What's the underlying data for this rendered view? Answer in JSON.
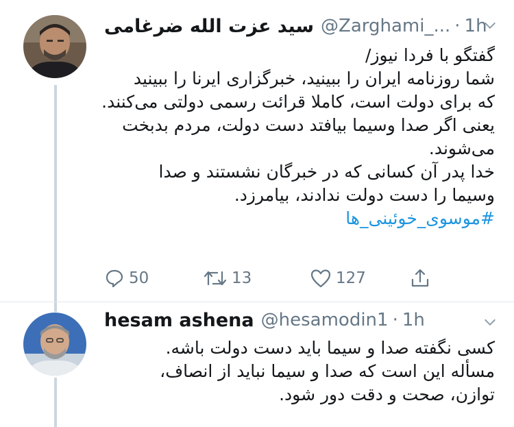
{
  "tweets": [
    {
      "name": "سید عزت الله ضرغامی",
      "handle": "@Zarghami_...",
      "separator": "·",
      "time": "1h",
      "lines": [
        "گفتگو با فردا نیوز/",
        "شما روزنامه ایران را ببینید، خبرگزاری ایرنا را ببینید",
        "که برای دولت است، کاملا قرائت رسمی دولتی می‌کنند.",
        "یعنی اگر صدا وسیما بیافتد دست دولت، مردم بدبخت",
        "می‌شوند.",
        "خدا پدر آن کسانی که در خبرگان نشستند و صدا",
        "وسیما را دست دولت ندادند، بیامرزد."
      ],
      "hashtag": "#موسوی_خوئینی_ها",
      "replies": "50",
      "retweets": "13",
      "likes": "127",
      "icons": [
        "reply-icon",
        "retweet-icon",
        "like-icon",
        "share-icon",
        "chevron-down-icon"
      ]
    },
    {
      "name": "hesam ashena",
      "handle": "@hesamodin1",
      "separator": "·",
      "time": "1h",
      "lines": [
        "کسی نگفته صدا و سیما باید دست دولت باشه.",
        "مسأله این است که صدا و سیما نباید از انصاف،",
        "توازن، صحت و دقت دور شود."
      ]
    }
  ],
  "colors": {
    "text": "#14171a",
    "secondary": "#657786",
    "link": "#1b95e0",
    "divider": "#e1e8ed",
    "thread": "#ccd6dd"
  }
}
